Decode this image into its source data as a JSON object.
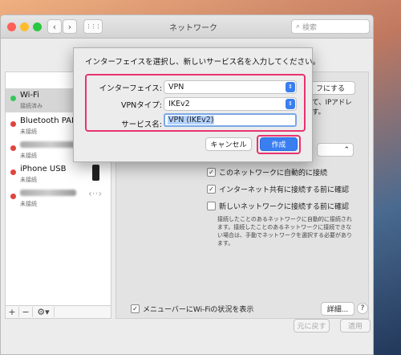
{
  "window": {
    "title": "ネットワーク",
    "search_placeholder": "検索",
    "back_icon": "‹",
    "forward_icon": "›",
    "grid_icon": "⋮⋮⋮",
    "search_icon": "⌕",
    "traffic_lights": [
      "#fe5f57",
      "#febc2e",
      "#28c840"
    ]
  },
  "sidebar": {
    "services": [
      {
        "name": "Wi-Fi",
        "status": "接続済み",
        "color": "#34c759"
      },
      {
        "name": "Bluetooth PAN",
        "status": "未接続",
        "color": "#e0443e"
      },
      {
        "name": "",
        "status": "未接続",
        "color": "#e0443e"
      },
      {
        "name": "iPhone USB",
        "status": "未接続",
        "color": "#e0443e"
      },
      {
        "name": "",
        "status": "未接続",
        "color": "#e0443e"
      }
    ],
    "controls": {
      "add": "+",
      "remove": "−",
      "gear": "⚙▾"
    }
  },
  "main": {
    "turn_off_button": "フにする",
    "ip_text_line1": "て、IPアドレ",
    "ip_text_line2": "す。",
    "auto_join_label": "このネットワークに自動的に接続",
    "ask_hotspot_label": "インターネット共有に接続する前に確認",
    "ask_new_label": "新しいネットワークに接続する前に確認",
    "info_line1": "接続したことのあるネットワークに自動的に接続され",
    "info_line2": "ます。接続したことのあるネットワークに接続できな",
    "info_line3": "い場合は、手動でネットワークを選択する必要があり",
    "info_line4": "ます。",
    "menubar_label": "メニューバーにWi-Fiの状況を表示",
    "advanced_button": "詳細...",
    "help_button": "?",
    "revert_button": "元に戻す",
    "apply_button": "適用"
  },
  "dialog": {
    "title": "インターフェイスを選択し、新しいサービス名を入力してください。",
    "interface_label": "インターフェイス:",
    "interface_value": "VPN",
    "vpn_type_label": "VPNタイプ:",
    "vpn_type_value": "IKEv2",
    "service_name_label": "サービス名:",
    "service_name_value": "VPN (IKEv2)",
    "cancel_button": "キャンセル",
    "create_button": "作成",
    "highlight_color": "#e8336e",
    "accent_color": "#3a7ef0"
  }
}
